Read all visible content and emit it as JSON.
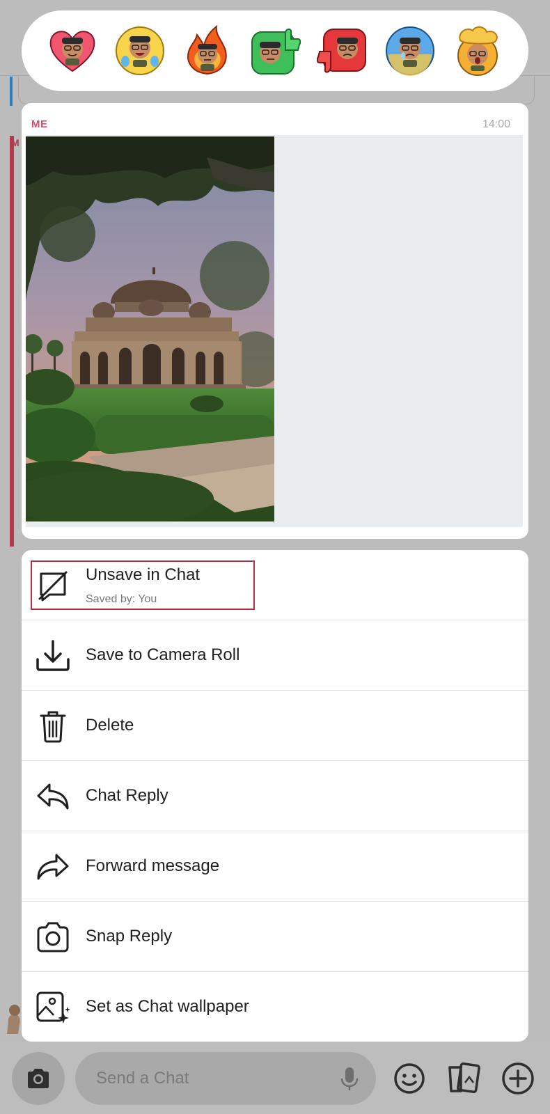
{
  "reactions": [
    {
      "name": "heart-eyes",
      "bg": "#f0566f"
    },
    {
      "name": "laughing",
      "bg": "#f7d44b"
    },
    {
      "name": "fire",
      "bg": "#f59a2d"
    },
    {
      "name": "thumbs-up",
      "bg": "#3fbf5a"
    },
    {
      "name": "thumbs-down",
      "bg": "#e5383b"
    },
    {
      "name": "crying",
      "bg": "#5ba9e8"
    },
    {
      "name": "mind-blown",
      "bg": "#f5b034"
    }
  ],
  "message": {
    "sender": "ME",
    "time": "14:00",
    "bg_sender_initial": "M"
  },
  "menu": {
    "items": [
      {
        "id": "unsave",
        "label": "Unsave in Chat",
        "sub": "Saved by: You",
        "icon": "unsave-icon"
      },
      {
        "id": "save-camera-roll",
        "label": "Save to Camera Roll",
        "icon": "download-icon"
      },
      {
        "id": "delete",
        "label": "Delete",
        "icon": "trash-icon"
      },
      {
        "id": "chat-reply",
        "label": "Chat Reply",
        "icon": "reply-arrow-icon"
      },
      {
        "id": "forward",
        "label": "Forward message",
        "icon": "forward-arrow-icon"
      },
      {
        "id": "snap-reply",
        "label": "Snap Reply",
        "icon": "camera-icon"
      },
      {
        "id": "set-wallpaper",
        "label": "Set as Chat wallpaper",
        "icon": "wallpaper-icon"
      }
    ]
  },
  "bottom_bar": {
    "placeholder": "Send a Chat"
  },
  "colors": {
    "accent_red": "#e04a69",
    "highlight_border": "#b3303f"
  }
}
